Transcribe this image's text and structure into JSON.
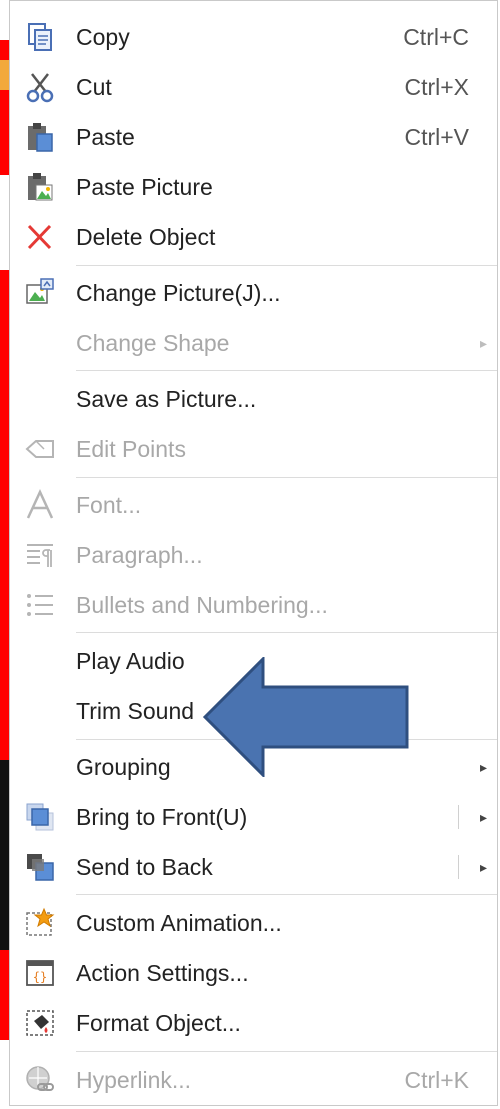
{
  "menu": {
    "items": [
      {
        "label": "Copy",
        "shortcut": "Ctrl+C",
        "icon": "copy-icon",
        "enabled": true
      },
      {
        "label": "Cut",
        "shortcut": "Ctrl+X",
        "icon": "scissors-icon",
        "enabled": true
      },
      {
        "label": "Paste",
        "shortcut": "Ctrl+V",
        "icon": "paste-icon",
        "enabled": true
      },
      {
        "label": "Paste Picture",
        "shortcut": "",
        "icon": "paste-picture-icon",
        "enabled": true
      },
      {
        "label": "Delete Object",
        "shortcut": "",
        "icon": "delete-x-icon",
        "enabled": true
      },
      {
        "label": "Change Picture(J)...",
        "shortcut": "",
        "icon": "change-picture-icon",
        "enabled": true
      },
      {
        "label": "Change Shape",
        "shortcut": "",
        "icon": "",
        "enabled": false,
        "submenu": true
      },
      {
        "label": "Save as Picture...",
        "shortcut": "",
        "icon": "",
        "enabled": true
      },
      {
        "label": "Edit Points",
        "shortcut": "",
        "icon": "edit-points-icon",
        "enabled": false
      },
      {
        "label": "Font...",
        "shortcut": "",
        "icon": "font-icon",
        "enabled": false
      },
      {
        "label": "Paragraph...",
        "shortcut": "",
        "icon": "paragraph-icon",
        "enabled": false
      },
      {
        "label": "Bullets and Numbering...",
        "shortcut": "",
        "icon": "bullets-icon",
        "enabled": false
      },
      {
        "label": "Play Audio",
        "shortcut": "",
        "icon": "",
        "enabled": true
      },
      {
        "label": "Trim Sound",
        "shortcut": "",
        "icon": "",
        "enabled": true
      },
      {
        "label": "Grouping",
        "shortcut": "",
        "icon": "",
        "enabled": true,
        "submenu": true
      },
      {
        "label": "Bring to Front(U)",
        "shortcut": "",
        "icon": "bring-to-front-icon",
        "enabled": true,
        "submenu": true
      },
      {
        "label": "Send to Back",
        "shortcut": "",
        "icon": "send-to-back-icon",
        "enabled": true,
        "submenu": true
      },
      {
        "label": "Custom Animation...",
        "shortcut": "",
        "icon": "custom-animation-icon",
        "enabled": true
      },
      {
        "label": "Action Settings...",
        "shortcut": "",
        "icon": "action-settings-icon",
        "enabled": true
      },
      {
        "label": "Format Object...",
        "shortcut": "",
        "icon": "format-object-icon",
        "enabled": true
      },
      {
        "label": "Hyperlink...",
        "shortcut": "Ctrl+K",
        "icon": "hyperlink-icon",
        "enabled": false
      }
    ]
  },
  "colors": {
    "callout_arrow": "#4a73b0",
    "callout_border": "#2f4f7f",
    "disabled_text": "#a8a8a8",
    "background_slide": "#ff0000"
  }
}
